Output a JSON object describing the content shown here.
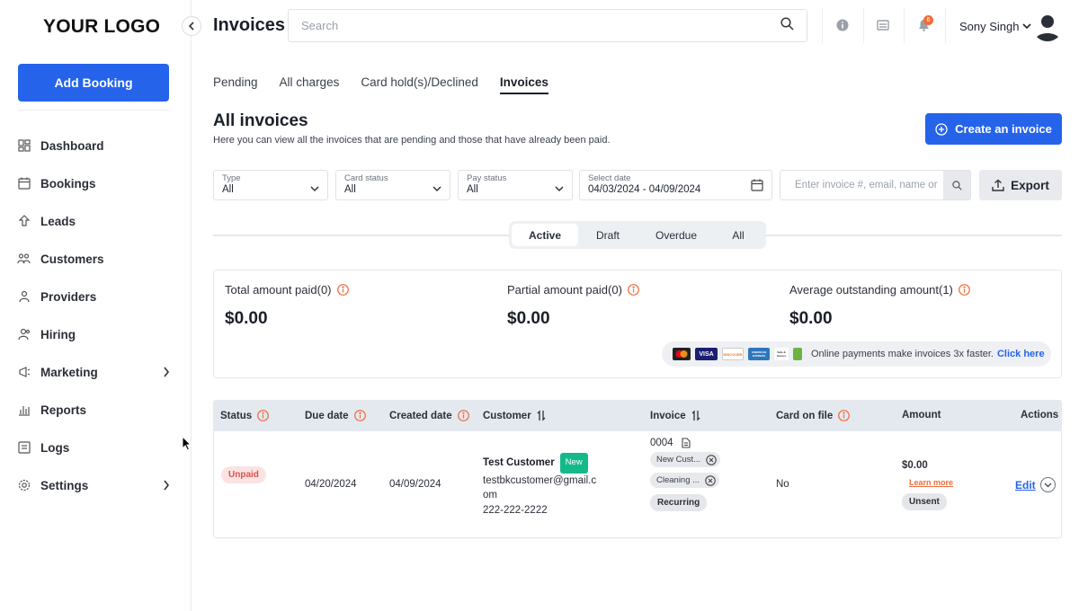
{
  "sidebar": {
    "logo": "YOUR LOGO",
    "add_booking": "Add Booking",
    "items": [
      {
        "label": "Dashboard",
        "icon": "dashboard-icon"
      },
      {
        "label": "Bookings",
        "icon": "calendar-icon"
      },
      {
        "label": "Leads",
        "icon": "leads-icon"
      },
      {
        "label": "Customers",
        "icon": "customers-icon"
      },
      {
        "label": "Providers",
        "icon": "providers-icon"
      },
      {
        "label": "Hiring",
        "icon": "hiring-icon"
      },
      {
        "label": "Marketing",
        "icon": "marketing-icon",
        "has_submenu": true
      },
      {
        "label": "Reports",
        "icon": "reports-icon"
      },
      {
        "label": "Logs",
        "icon": "logs-icon"
      },
      {
        "label": "Settings",
        "icon": "gear-icon",
        "has_submenu": true
      }
    ]
  },
  "header": {
    "title": "Invoices",
    "search_placeholder": "Search",
    "notification_count": "6",
    "user_name": "Sony Singh"
  },
  "tabs": [
    {
      "label": "Pending",
      "active": false
    },
    {
      "label": "All charges",
      "active": false
    },
    {
      "label": "Card hold(s)/Declined",
      "active": false
    },
    {
      "label": "Invoices",
      "active": true
    }
  ],
  "section": {
    "title": "All invoices",
    "subtitle": "Here you can view all the invoices that are pending and those that have already been paid.",
    "create_button": "Create an invoice"
  },
  "filters": {
    "type": {
      "label": "Type",
      "value": "All"
    },
    "card_status": {
      "label": "Card status",
      "value": "All"
    },
    "pay_status": {
      "label": "Pay status",
      "value": "All"
    },
    "date": {
      "label": "Select date",
      "value": "04/03/2024 - 04/09/2024"
    },
    "invoice_search_placeholder": "Enter invoice #, email, name or",
    "export": "Export"
  },
  "segments": [
    {
      "label": "Active",
      "active": true
    },
    {
      "label": "Draft",
      "active": false
    },
    {
      "label": "Overdue",
      "active": false
    },
    {
      "label": "All",
      "active": false
    }
  ],
  "summary": {
    "total_paid_label": "Total amount paid(0)",
    "total_paid_value": "$0.00",
    "partial_paid_label": "Partial amount paid(0)",
    "partial_paid_value": "$0.00",
    "avg_outstanding_label": "Average outstanding amount(1)",
    "avg_outstanding_value": "$0.00",
    "payment_text": "Online payments make invoices 3x faster.",
    "payment_link": "Click here",
    "card_logos": [
      "VISA",
      "DISCOVER",
      "AMERICAN EXPRESS",
      "Safe & Secure"
    ]
  },
  "table": {
    "columns": {
      "status": "Status",
      "due_date": "Due date",
      "created_date": "Created date",
      "customer": "Customer",
      "invoice": "Invoice",
      "card_on_file": "Card on file",
      "amount": "Amount",
      "actions": "Actions"
    },
    "rows": [
      {
        "status": "Unpaid",
        "due_date": "04/20/2024",
        "created_date": "04/09/2024",
        "customer_name": "Test Customer",
        "customer_badge": "New",
        "customer_email_1": "testbkcustomer@gmail.c",
        "customer_email_2": "om",
        "customer_phone": "222-222-2222",
        "invoice_number": "0004",
        "invoice_tag_1": "New Cust...",
        "invoice_tag_2": "Cleaning ...",
        "invoice_recurring": "Recurring",
        "card_on_file": "No",
        "amount": "$0.00",
        "learn_more": "Learn more",
        "send_status": "Unsent",
        "edit": "Edit"
      }
    ]
  },
  "colors": {
    "primary": "#2563eb",
    "accent_orange": "#f26b3a",
    "new_badge": "#14b98a",
    "unpaid_text": "#d9534f"
  }
}
